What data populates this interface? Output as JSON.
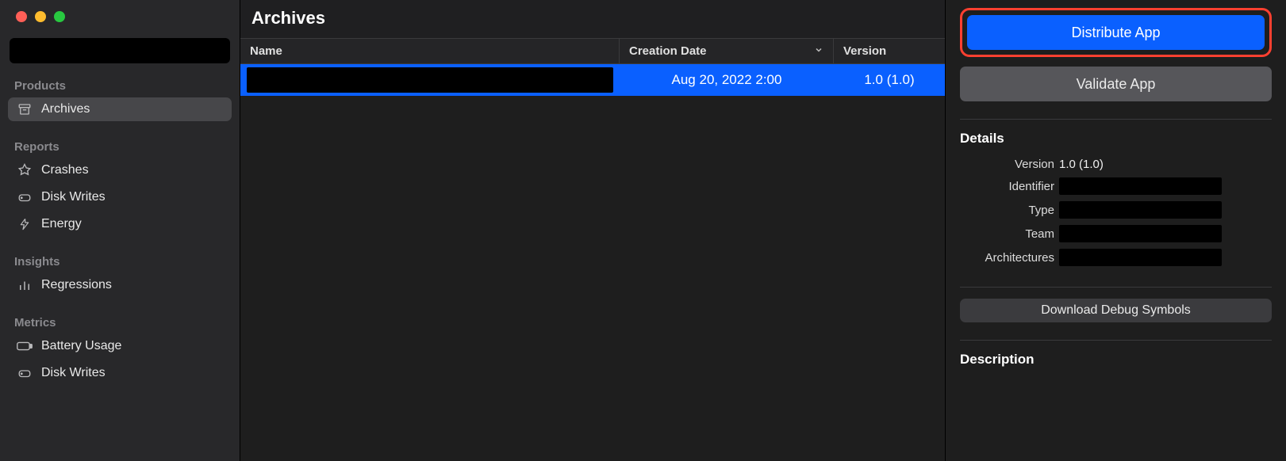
{
  "sidebar": {
    "sections": [
      {
        "label": "Products",
        "items": [
          {
            "label": "Archives",
            "icon": "archive-icon",
            "selected": true
          }
        ]
      },
      {
        "label": "Reports",
        "items": [
          {
            "label": "Crashes",
            "icon": "crash-icon",
            "selected": false
          },
          {
            "label": "Disk Writes",
            "icon": "disk-icon",
            "selected": false
          },
          {
            "label": "Energy",
            "icon": "energy-icon",
            "selected": false
          }
        ]
      },
      {
        "label": "Insights",
        "items": [
          {
            "label": "Regressions",
            "icon": "bars-icon",
            "selected": false
          }
        ]
      },
      {
        "label": "Metrics",
        "items": [
          {
            "label": "Battery Usage",
            "icon": "battery-icon",
            "selected": false
          },
          {
            "label": "Disk Writes",
            "icon": "disk-icon",
            "selected": false
          }
        ]
      }
    ]
  },
  "center": {
    "title": "Archives",
    "columns": {
      "name": "Name",
      "date": "Creation Date",
      "version": "Version"
    },
    "rows": [
      {
        "name": "",
        "date": "Aug 20, 2022 2:00",
        "version": "1.0 (1.0)"
      }
    ]
  },
  "inspector": {
    "distribute_label": "Distribute App",
    "validate_label": "Validate App",
    "details_heading": "Details",
    "fields": {
      "version_label": "Version",
      "version_value": "1.0 (1.0)",
      "identifier_label": "Identifier",
      "identifier_value": "",
      "type_label": "Type",
      "type_value": "",
      "team_label": "Team",
      "team_value": "",
      "arch_label": "Architectures",
      "arch_value": ""
    },
    "download_label": "Download Debug Symbols",
    "description_heading": "Description"
  }
}
